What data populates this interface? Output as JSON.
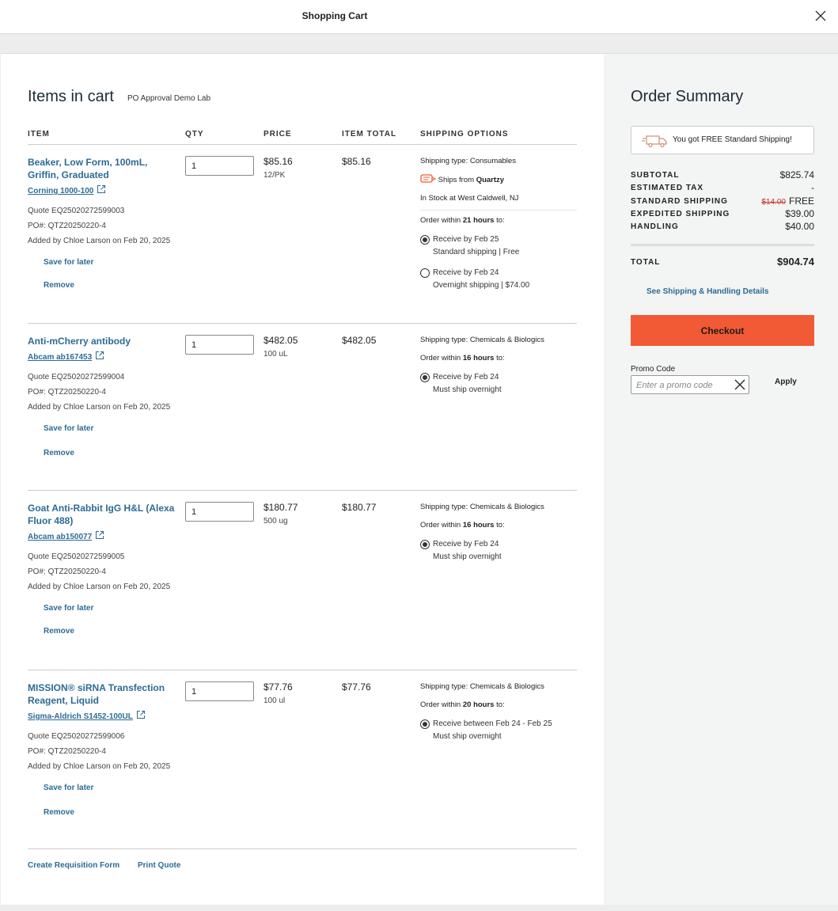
{
  "window": {
    "title": "Shopping Cart"
  },
  "cart": {
    "heading": "Items in cart",
    "lab": "PO Approval Demo Lab",
    "columns": {
      "item": "ITEM",
      "qty": "QTY",
      "price": "PRICE",
      "item_total": "ITEM TOTAL",
      "shipping": "SHIPPING OPTIONS"
    },
    "save_for_later": "Save for later",
    "remove": "Remove",
    "items": [
      {
        "name": "Beaker, Low Form, 100mL, Griffin, Graduated",
        "sku": "Corning 1000-100",
        "quote": "Quote EQ25020272599003",
        "po": "PO#: QTZ20250220-4",
        "added": "Added by Chloe Larson on Feb 20, 2025",
        "qty": "1",
        "price": "$85.16",
        "unit": "12/PK",
        "item_total": "$85.16",
        "shipping_type_label": "Shipping type: ",
        "shipping_type": "Consumables",
        "ships_from_label": "Ships from ",
        "ships_from": "Quartzy",
        "stock": "In Stock at West Caldwell, NJ",
        "order_within_pre": "Order within ",
        "order_within_hours": "21 hours",
        "order_within_post": " to:",
        "options": [
          {
            "line1": "Receive by Feb 25",
            "line2": "Standard shipping | Free",
            "selected": true
          },
          {
            "line1": "Receive by Feb 24",
            "line2": "Overnight shipping | $74.00",
            "selected": false
          }
        ]
      },
      {
        "name": "Anti-mCherry antibody",
        "sku": "Abcam ab167453",
        "quote": "Quote EQ25020272599004",
        "po": "PO#: QTZ20250220-4",
        "added": "Added by Chloe Larson on Feb 20, 2025",
        "qty": "1",
        "price": "$482.05",
        "unit": "100 uL",
        "item_total": "$482.05",
        "shipping_type_label": "Shipping type: ",
        "shipping_type": "Chemicals & Biologics",
        "order_within_pre": "Order within ",
        "order_within_hours": "16 hours",
        "order_within_post": " to:",
        "options": [
          {
            "line1": "Receive by Feb 24",
            "line2": "Must ship overnight",
            "selected": true
          }
        ]
      },
      {
        "name": "Goat Anti-Rabbit IgG H&L (Alexa Fluor 488)",
        "sku": "Abcam ab150077",
        "quote": "Quote EQ25020272599005",
        "po": "PO#: QTZ20250220-4",
        "added": "Added by Chloe Larson on Feb 20, 2025",
        "qty": "1",
        "price": "$180.77",
        "unit": "500 ug",
        "item_total": "$180.77",
        "shipping_type_label": "Shipping type: ",
        "shipping_type": "Chemicals & Biologics",
        "order_within_pre": "Order within ",
        "order_within_hours": "16 hours",
        "order_within_post": " to:",
        "options": [
          {
            "line1": "Receive by Feb 24",
            "line2": "Must ship overnight",
            "selected": true
          }
        ]
      },
      {
        "name": "MISSION® siRNA Transfection Reagent, Liquid",
        "sku": "Sigma-Aldrich S1452-100UL",
        "quote": "Quote EQ25020272599006",
        "po": "PO#: QTZ20250220-4",
        "added": "Added by Chloe Larson on Feb 20, 2025",
        "qty": "1",
        "price": "$77.76",
        "unit": "100 ul",
        "item_total": "$77.76",
        "shipping_type_label": "Shipping type: ",
        "shipping_type": "Chemicals & Biologics",
        "order_within_pre": "Order within ",
        "order_within_hours": "20 hours",
        "order_within_post": " to:",
        "options": [
          {
            "line1": "Receive between Feb 24 - Feb 25",
            "line2": "Must ship overnight",
            "selected": true
          }
        ]
      }
    ],
    "footer": {
      "requisition": "Create Requisition Form",
      "print": "Print Quote"
    }
  },
  "summary": {
    "title": "Order Summary",
    "free_banner": "You got FREE Standard Shipping!",
    "rows": {
      "subtotal": {
        "label": "SUBTOTAL",
        "value": "$825.74"
      },
      "tax": {
        "label": "ESTIMATED TAX",
        "value": "-"
      },
      "standard": {
        "label": "STANDARD SHIPPING",
        "old": "$14.00",
        "value": "FREE"
      },
      "expedited": {
        "label": "EXPEDITED SHIPPING",
        "value": "$39.00"
      },
      "handling": {
        "label": "HANDLING",
        "value": "$40.00"
      }
    },
    "total_label": "TOTAL",
    "total_value": "$904.74",
    "see_details": "See Shipping & Handling Details",
    "checkout": "Checkout",
    "promo_label": "Promo Code",
    "promo_placeholder": "Enter a promo code",
    "promo_value": "",
    "apply": "Apply"
  },
  "colors": {
    "accent": "#f15a35",
    "link": "#2c6b94",
    "discount": "#c0392b"
  },
  "icons": [
    "close-icon",
    "external-link-icon",
    "quartzy-logo-icon",
    "truck-icon",
    "clear-icon"
  ]
}
